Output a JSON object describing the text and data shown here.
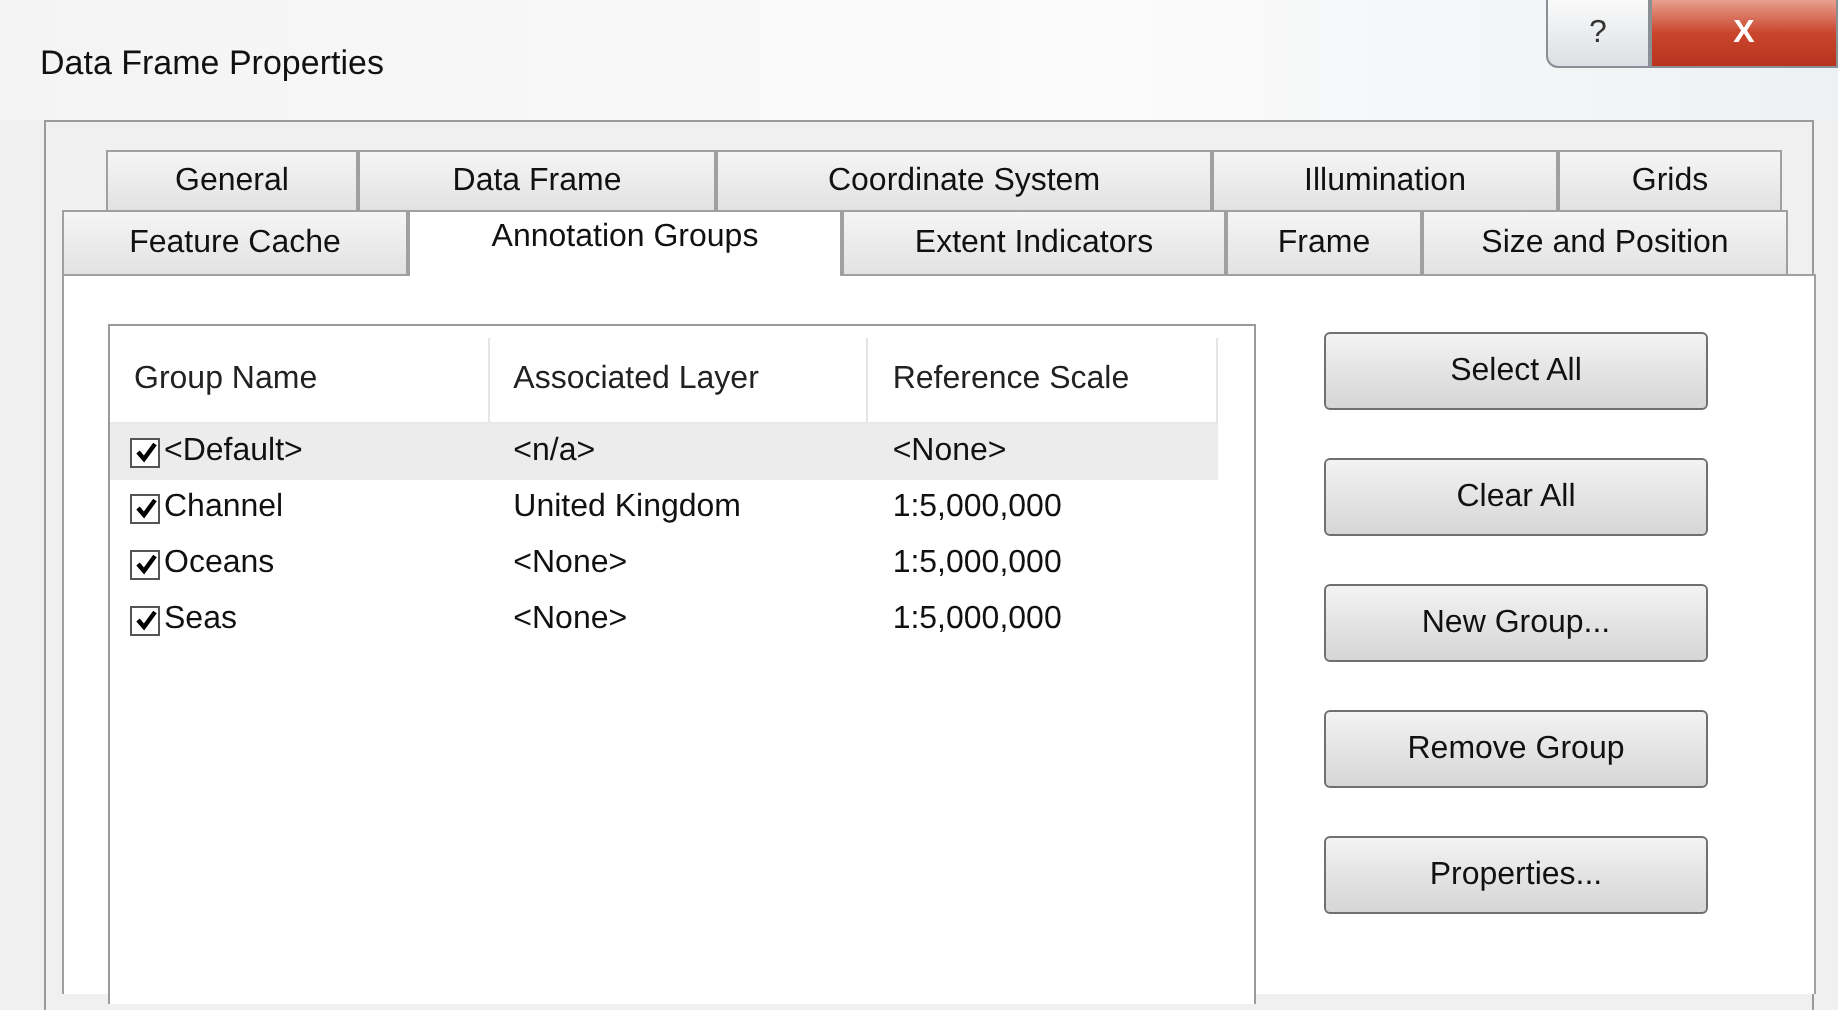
{
  "window": {
    "title": "Data Frame Properties",
    "help": "?",
    "close": "X"
  },
  "tab_rows": [
    [
      {
        "label": "General",
        "selected": false
      },
      {
        "label": "Data Frame",
        "selected": false
      },
      {
        "label": "Coordinate System",
        "selected": false
      },
      {
        "label": "Illumination",
        "selected": false
      },
      {
        "label": "Grids",
        "selected": false
      }
    ],
    [
      {
        "label": "Feature Cache",
        "selected": false
      },
      {
        "label": "Annotation Groups",
        "selected": true
      },
      {
        "label": "Extent Indicators",
        "selected": false
      },
      {
        "label": "Frame",
        "selected": false
      },
      {
        "label": "Size and Position",
        "selected": false
      }
    ]
  ],
  "table": {
    "columns": [
      "Group Name",
      "Associated Layer",
      "Reference Scale"
    ],
    "rows": [
      {
        "name": "<Default>",
        "layer": "<n/a>",
        "scale": "<None>",
        "checked": true,
        "selected": true
      },
      {
        "name": "Channel",
        "layer": "United Kingdom",
        "scale": "1:5,000,000",
        "checked": true,
        "selected": false
      },
      {
        "name": "Oceans",
        "layer": "<None>",
        "scale": "1:5,000,000",
        "checked": true,
        "selected": false
      },
      {
        "name": "Seas",
        "layer": "<None>",
        "scale": "1:5,000,000",
        "checked": true,
        "selected": false
      }
    ]
  },
  "buttons": [
    "Select All",
    "Clear All",
    "New Group...",
    "Remove Group",
    "Properties..."
  ]
}
